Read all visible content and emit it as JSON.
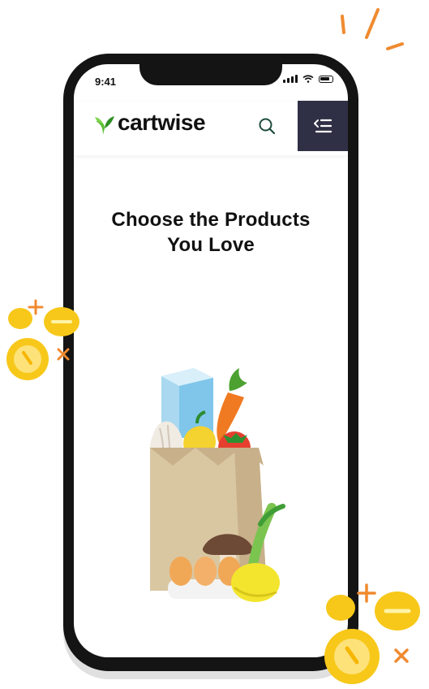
{
  "status_bar": {
    "time": "9:41"
  },
  "header": {
    "brand_name": "cartwise",
    "search_icon": "search-icon",
    "menu_icon": "menu-icon"
  },
  "content": {
    "headline": "Choose the Products You Love"
  },
  "colors": {
    "brand_green": "#4caf2a",
    "menu_bg": "#2f2f45",
    "coin_yellow": "#f7c81a",
    "spark_orange": "#f08a2f"
  }
}
